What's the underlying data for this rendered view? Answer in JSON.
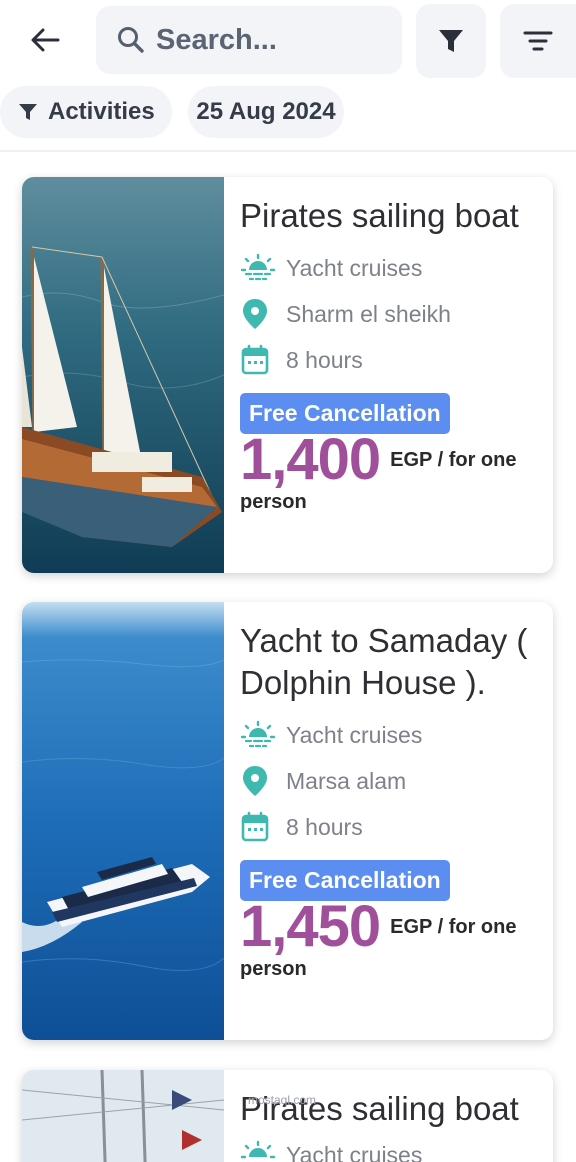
{
  "search": {
    "placeholder": "Search..."
  },
  "filters": {
    "activities_label": "Activities",
    "date_label": "25 Aug 2024"
  },
  "colors": {
    "accent_price": "#a0509a",
    "badge": "#5b8ef0",
    "icon_teal": "#3fb8b0"
  },
  "listings": [
    {
      "title": "Pirates sailing boat",
      "category": "Yacht cruises",
      "location": "Sharm el sheikh",
      "duration": "8 hours",
      "badge": "Free Cancellation",
      "price": "1,400",
      "unit_a": "EGP / for one",
      "unit_b": "person"
    },
    {
      "title": "Yacht to Samaday ( Dolphin House ).",
      "category": "Yacht cruises",
      "location": "Marsa alam",
      "duration": "8 hours",
      "badge": "Free Cancellation",
      "price": "1,450",
      "unit_a": "EGP / for one",
      "unit_b": "person"
    },
    {
      "title": "Pirates sailing boat",
      "category": "Yacht cruises"
    }
  ],
  "watermark": "mostaql.com"
}
